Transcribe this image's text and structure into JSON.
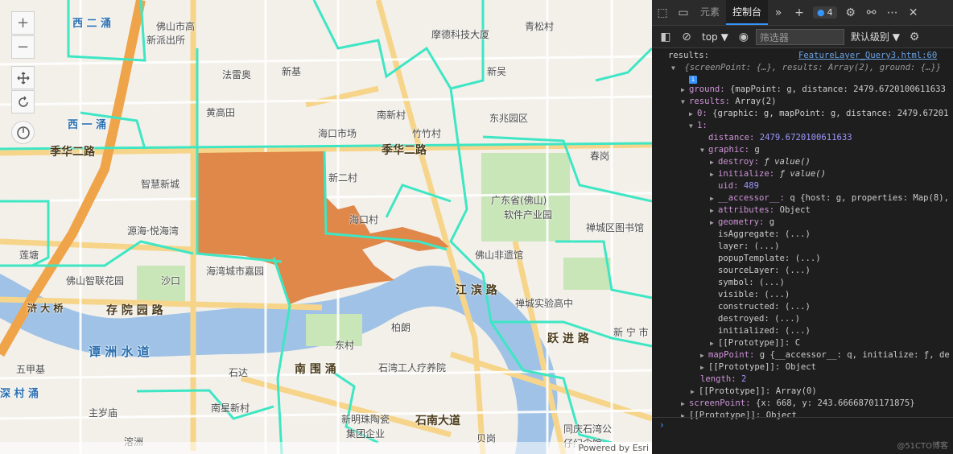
{
  "map": {
    "labels": {
      "l1": "西 二 涌",
      "l2": "佛山市高",
      "l3": "新派出所",
      "l4": "元素",
      "l5": "摩德科技大厦",
      "l6": "青松村",
      "l7": "法雷奥",
      "l8": "新基",
      "l9": "新吴",
      "l10": "黄高田",
      "l11": "南新村",
      "l12": "东兆园区",
      "l13": "海口市场",
      "l14": "竹竹村",
      "l15": "季华二路",
      "l16": "季华二路",
      "l17": "春岗",
      "l18": "智慧新城",
      "l19": "新二村",
      "l20": "广东省(佛山)",
      "l21": "软件产业园",
      "l22": "海口村",
      "l23": "禅城区图书馆",
      "l24": "源海·悦海湾",
      "l25": "海湾城市嘉园",
      "l26": "佛山智联花园",
      "l27": "沙口",
      "l28": "佛山非遗馆",
      "l29": "禅城实验高中",
      "l30": "柏朗",
      "l31": "东村",
      "l32": "石湾工人疗养院",
      "l33": "石达",
      "l34": "五甲基",
      "l35": "主岁庙",
      "l36": "南星新村",
      "l37": "新明珠陶瓷",
      "l38": "集团企业",
      "l39": "贝岗",
      "l40": "同庆石湾公",
      "l41": "仔纪念馆",
      "l42": "溶洲",
      "l43": "莲塘",
      "r1": "西 一 涌",
      "r2": "谭 洲 水 道",
      "r3": "存 院 园 路",
      "r4": "深 村 涌",
      "r5": "浒 大 桥",
      "r6": "石南大道",
      "r7": "江 滨 路",
      "r8": "跃 进 路",
      "r9": "新 宁 市",
      "r10": "南 围 涌"
    },
    "controls": {
      "zoom_in": "+",
      "zoom_out": "−"
    },
    "attribution": "Powered by Esri"
  },
  "devtools": {
    "tabs": {
      "elements": "元素",
      "console": "控制台"
    },
    "badge_count": "4",
    "toolbar": {
      "context": "top",
      "filter_placeholder": "筛选器",
      "level": "默认级别"
    },
    "lines": {
      "a0": "results:",
      "a0link": "FeatureLayer_Query3.html:60",
      "a1": "{screenPoint: {…}, results: Array(2), ground: {…}}",
      "b1k": "ground:",
      "b1v": "{mapPoint: g, distance: 2479.6720100611633",
      "b2k": "results:",
      "b2v": "Array(2)",
      "b3k": "0:",
      "b3v": "{graphic: g, mapPoint: g, distance: 2479.67201",
      "b4k": "1:",
      "b5k": "distance:",
      "b5v": "2479.6720100611633",
      "b6k": "graphic:",
      "b6v": "g",
      "b7k": "destroy:",
      "b7v": "ƒ value()",
      "b8k": "initialize:",
      "b8v": "ƒ value()",
      "b9k": "uid:",
      "b9v": "489",
      "b10k": "__accessor__:",
      "b10v": "q {host: g, properties: Map(8),",
      "b11k": "attributes:",
      "b11v": "Object",
      "b12k": "geometry:",
      "b12v": "g",
      "b13k": "isAggregate:",
      "b13v": "(...)",
      "b14k": "layer:",
      "b14v": "(...)",
      "b15k": "popupTemplate:",
      "b15v": "(...)",
      "b16k": "sourceLayer:",
      "b16v": "(...)",
      "b17k": "symbol:",
      "b17v": "(...)",
      "b18k": "visible:",
      "b18v": "(...)",
      "b19k": "constructed:",
      "b19v": "(...)",
      "b20k": "destroyed:",
      "b20v": "(...)",
      "b21k": "initialized:",
      "b21v": "(...)",
      "b22k": "[[Prototype]]:",
      "b22v": "C",
      "b23k": "mapPoint:",
      "b23v": "g {__accessor__: q, initialize: ƒ, de",
      "b24k": "[[Prototype]]:",
      "b24v": "Object",
      "b25k": "length:",
      "b25v": "2",
      "b26k": "[[Prototype]]:",
      "b26v": "Array(0)",
      "b27k": "screenPoint:",
      "b27v": "{x: 668, y: 243.66668701171875}",
      "b28k": "[[Prototype]]:",
      "b28v": "Object"
    },
    "watermark": "@51CTO博客"
  }
}
